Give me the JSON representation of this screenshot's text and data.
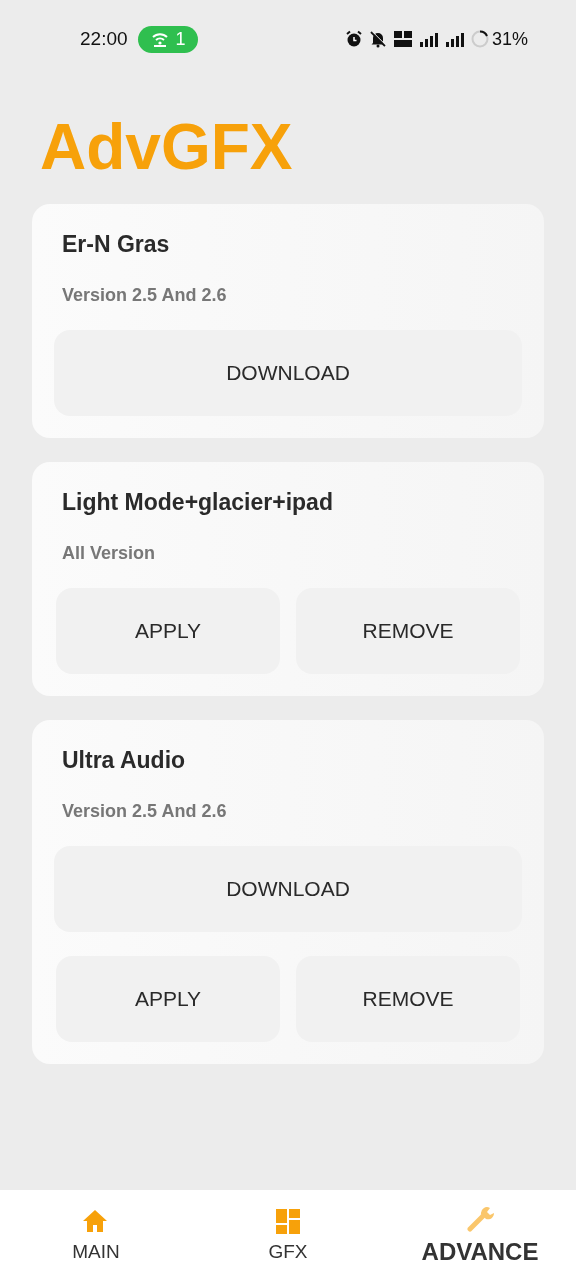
{
  "status_bar": {
    "time": "22:00",
    "hotspot_count": "1",
    "battery": "31%"
  },
  "app_title": "AdvGFX",
  "cards": [
    {
      "title": "Er-N Gras",
      "subtitle": "Version 2.5 And 2.6",
      "button_rows": [
        [
          "DOWNLOAD"
        ]
      ]
    },
    {
      "title": "Light Mode+glacier+ipad",
      "subtitle": "All Version",
      "button_rows": [
        [
          "APPLY",
          "REMOVE"
        ]
      ]
    },
    {
      "title": "Ultra Audio",
      "subtitle": "Version 2.5 And 2.6",
      "button_rows": [
        [
          "DOWNLOAD"
        ],
        [
          "APPLY",
          "REMOVE"
        ]
      ]
    }
  ],
  "nav": [
    {
      "kind": "home",
      "label": "MAIN",
      "selected": false
    },
    {
      "kind": "grid",
      "label": "GFX",
      "selected": false
    },
    {
      "kind": "wrench",
      "label": "ADVANCE",
      "selected": true
    }
  ]
}
